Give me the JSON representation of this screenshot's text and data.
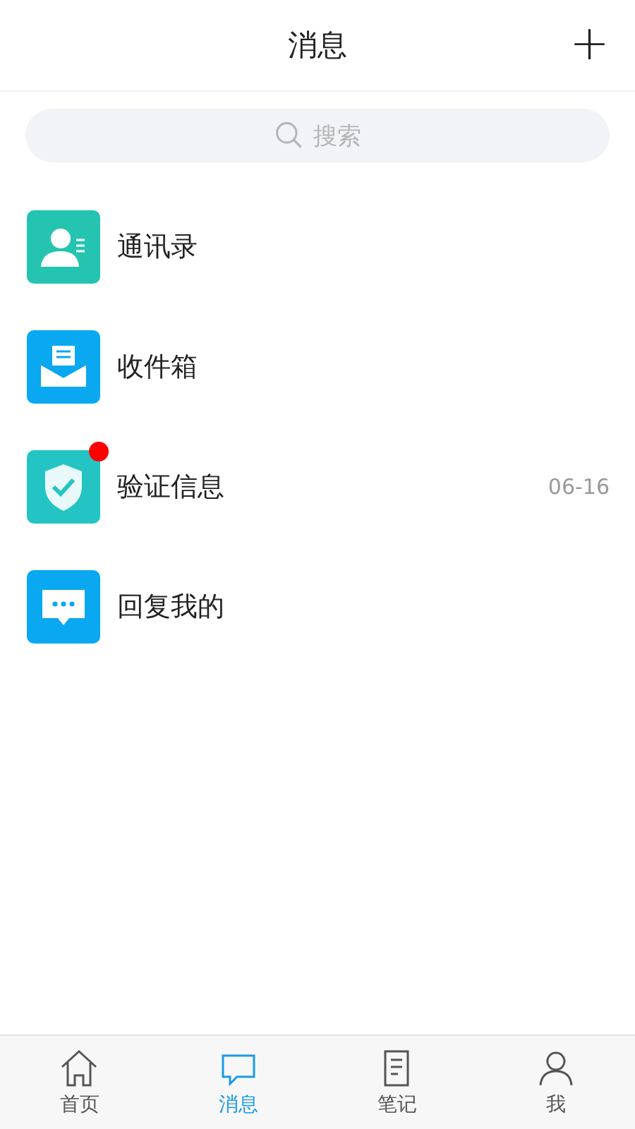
{
  "header": {
    "title": "消息",
    "add_button": "+"
  },
  "search": {
    "placeholder": "搜索"
  },
  "items": [
    {
      "kind": "contacts",
      "label": "通讯录",
      "badge": false
    },
    {
      "kind": "inbox",
      "label": "收件箱",
      "badge": false
    },
    {
      "kind": "verify",
      "label": "验证信息",
      "badge": true,
      "time": "06-16"
    },
    {
      "kind": "replies",
      "label": "回复我的",
      "badge": false
    }
  ],
  "tabs": [
    {
      "kind": "home",
      "label": "首页",
      "selected": false
    },
    {
      "kind": "messages",
      "label": "消息",
      "selected": true
    },
    {
      "kind": "notes",
      "label": "笔记",
      "selected": false
    },
    {
      "kind": "me",
      "label": "我",
      "selected": false
    }
  ]
}
